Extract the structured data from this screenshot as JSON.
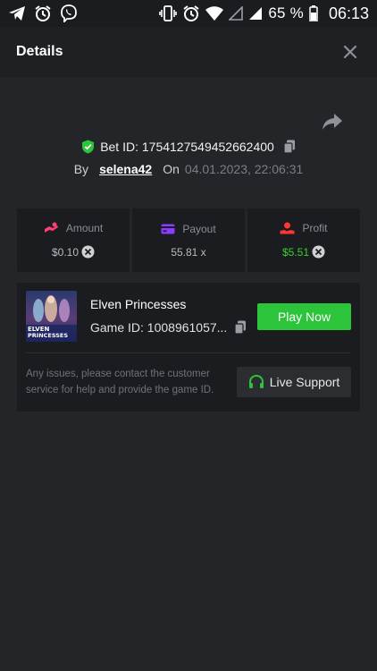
{
  "status_bar": {
    "battery": "65 %",
    "time": "06:13",
    "left_icons": [
      "telegram-icon",
      "alarm-icon",
      "viber-icon"
    ],
    "right_icons": [
      "vibrate-icon",
      "alarm-icon",
      "wifi-icon",
      "signal-icon",
      "signal-icon",
      "battery-icon"
    ]
  },
  "header": {
    "title": "Details"
  },
  "bet": {
    "id_text": "Bet ID: 1754127549452662400",
    "by_label": "By",
    "username": "selena42",
    "on_label": "On",
    "date": "04.01.2023, 22:06:31"
  },
  "stats": {
    "amount": {
      "label": "Amount",
      "value": "$0.10",
      "accent": "#ff3e78"
    },
    "payout": {
      "label": "Payout",
      "value": "55.81 x",
      "accent": "#8a3dff"
    },
    "profit": {
      "label": "Profit",
      "value": "$5.51",
      "accent": "#ff3535",
      "value_color": "#3ccf2d"
    }
  },
  "game": {
    "name": "Elven Princesses",
    "game_id": "Game ID: 1008961057...",
    "play_label": "Play Now",
    "thumb_title_1": "ELVEN",
    "thumb_title_2": "PRINCESSES",
    "support_text": "Any issues, please contact the customer service for help and provide the game ID.",
    "live_support_label": "Live Support"
  },
  "colors": {
    "background": "#232528",
    "card": "#1b1c1f",
    "accent_green": "#2cc43a",
    "shield_green": "#2cc43a"
  }
}
